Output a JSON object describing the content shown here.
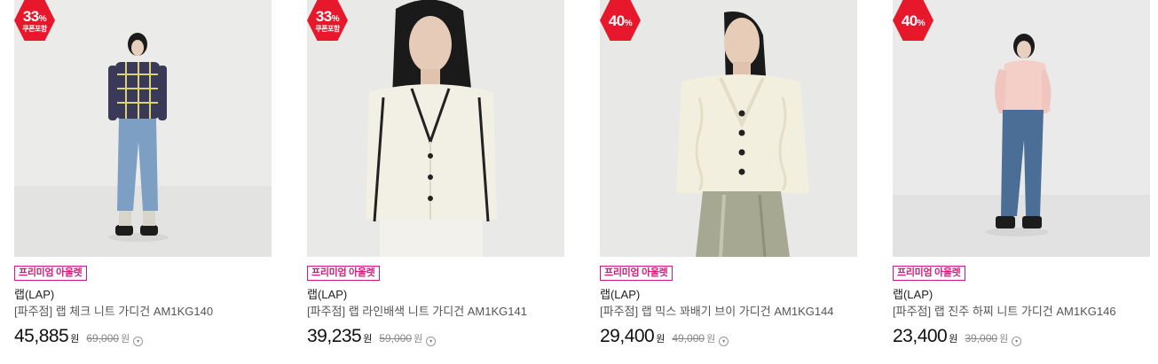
{
  "products": [
    {
      "badge_rate": "33",
      "badge_unit": "%",
      "badge_sub": "쿠폰포함",
      "tag": "프리미엄 아울렛",
      "brand": "랩(LAP)",
      "title": "[파주점] 랩 체크 니트 가디건 AM1KG140",
      "price": "45,885",
      "price_unit": "원",
      "original_price": "69,000",
      "original_unit": "원",
      "info_icon": "info-circle-icon"
    },
    {
      "badge_rate": "33",
      "badge_unit": "%",
      "badge_sub": "쿠폰포함",
      "tag": "프리미엄 아울렛",
      "brand": "랩(LAP)",
      "title": "[파주점] 랩 라인배색 니트 가디건 AM1KG141",
      "price": "39,235",
      "price_unit": "원",
      "original_price": "59,000",
      "original_unit": "원",
      "info_icon": "info-circle-icon"
    },
    {
      "badge_rate": "40",
      "badge_unit": "%",
      "tag": "프리미엄 아울렛",
      "brand": "랩(LAP)",
      "title": "[파주점] 랩 믹스 꽈배기 브이 가디건 AM1KG144",
      "price": "29,400",
      "price_unit": "원",
      "original_price": "49,000",
      "original_unit": "원",
      "info_icon": "info-circle-icon"
    },
    {
      "badge_rate": "40",
      "badge_unit": "%",
      "tag": "프리미엄 아울렛",
      "brand": "랩(LAP)",
      "title": "[파주점] 랩 진주 하찌 니트 가디건 AM1KG146",
      "price": "23,400",
      "price_unit": "원",
      "original_price": "39,000",
      "original_unit": "원",
      "info_icon": "info-circle-icon"
    }
  ],
  "colors": {
    "badge": "#e8182c",
    "tag": "#d31a7c",
    "photo_background": "#ececec"
  }
}
